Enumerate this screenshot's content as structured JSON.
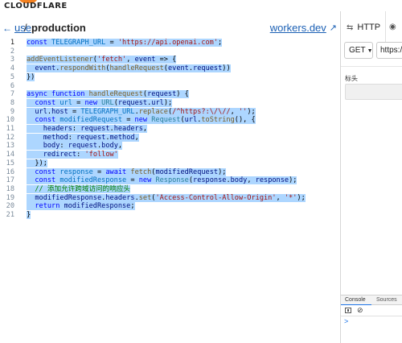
{
  "brand": {
    "logo_text": "CLOUDFLARE",
    "accent": "#f48120"
  },
  "header": {
    "back_label": "use",
    "separator": "/",
    "title": "production",
    "link_label": "workers.dev"
  },
  "panel": {
    "tab_http": "HTTP",
    "method": "GET",
    "url_value": "https://",
    "headers_label": "标头",
    "console_tab": "Console",
    "sources_tab": "Sources",
    "prompt": ">"
  },
  "editor": {
    "lines": [
      [
        [
          "kw",
          "const "
        ],
        [
          "cst",
          "TELEGRAPH_URL"
        ],
        [
          "plain",
          " = "
        ],
        [
          "str",
          "'https://api.openai.com'"
        ],
        [
          "plain",
          ";"
        ]
      ],
      [],
      [
        [
          "fn",
          "addEventListener"
        ],
        [
          "plain",
          "("
        ],
        [
          "str",
          "'fetch'"
        ],
        [
          "plain",
          ", "
        ],
        [
          "var",
          "event"
        ],
        [
          "plain",
          " => {"
        ]
      ],
      [
        [
          "plain",
          "  "
        ],
        [
          "var",
          "event"
        ],
        [
          "plain",
          "."
        ],
        [
          "fn",
          "respondWith"
        ],
        [
          "plain",
          "("
        ],
        [
          "fn",
          "handleRequest"
        ],
        [
          "plain",
          "("
        ],
        [
          "var",
          "event"
        ],
        [
          "plain",
          "."
        ],
        [
          "var",
          "request"
        ],
        [
          "plain",
          "))"
        ]
      ],
      [
        [
          "plain",
          "})"
        ]
      ],
      [],
      [
        [
          "kw",
          "async function "
        ],
        [
          "fn",
          "handleRequest"
        ],
        [
          "plain",
          "("
        ],
        [
          "var",
          "request"
        ],
        [
          "plain",
          ") {"
        ]
      ],
      [
        [
          "plain",
          "  "
        ],
        [
          "kw",
          "const "
        ],
        [
          "cst",
          "url"
        ],
        [
          "plain",
          " = "
        ],
        [
          "kw",
          "new "
        ],
        [
          "cls",
          "URL"
        ],
        [
          "plain",
          "("
        ],
        [
          "var",
          "request"
        ],
        [
          "plain",
          "."
        ],
        [
          "var",
          "url"
        ],
        [
          "plain",
          ");"
        ]
      ],
      [
        [
          "plain",
          "  "
        ],
        [
          "var",
          "url"
        ],
        [
          "plain",
          "."
        ],
        [
          "var",
          "host"
        ],
        [
          "plain",
          " = "
        ],
        [
          "cst",
          "TELEGRAPH_URL"
        ],
        [
          "plain",
          "."
        ],
        [
          "fn",
          "replace"
        ],
        [
          "plain",
          "("
        ],
        [
          "str",
          "/^https?:\\/\\//"
        ],
        [
          "plain",
          ", "
        ],
        [
          "str",
          "''"
        ],
        [
          "plain",
          ");"
        ]
      ],
      [
        [
          "plain",
          "  "
        ],
        [
          "kw",
          "const "
        ],
        [
          "cst",
          "modifiedRequest"
        ],
        [
          "plain",
          " = "
        ],
        [
          "kw",
          "new "
        ],
        [
          "cls",
          "Request"
        ],
        [
          "plain",
          "("
        ],
        [
          "var",
          "url"
        ],
        [
          "plain",
          "."
        ],
        [
          "fn",
          "toString"
        ],
        [
          "plain",
          "(), {"
        ]
      ],
      [
        [
          "plain",
          "    "
        ],
        [
          "var",
          "headers"
        ],
        [
          "plain",
          ": "
        ],
        [
          "var",
          "request"
        ],
        [
          "plain",
          "."
        ],
        [
          "var",
          "headers"
        ],
        [
          "plain",
          ","
        ]
      ],
      [
        [
          "plain",
          "    "
        ],
        [
          "var",
          "method"
        ],
        [
          "plain",
          ": "
        ],
        [
          "var",
          "request"
        ],
        [
          "plain",
          "."
        ],
        [
          "var",
          "method"
        ],
        [
          "plain",
          ","
        ]
      ],
      [
        [
          "plain",
          "    "
        ],
        [
          "var",
          "body"
        ],
        [
          "plain",
          ": "
        ],
        [
          "var",
          "request"
        ],
        [
          "plain",
          "."
        ],
        [
          "var",
          "body"
        ],
        [
          "plain",
          ","
        ]
      ],
      [
        [
          "plain",
          "    "
        ],
        [
          "var",
          "redirect"
        ],
        [
          "plain",
          ": "
        ],
        [
          "str",
          "'follow'"
        ]
      ],
      [
        [
          "plain",
          "  });"
        ]
      ],
      [
        [
          "plain",
          "  "
        ],
        [
          "kw",
          "const "
        ],
        [
          "cst",
          "response"
        ],
        [
          "plain",
          " = "
        ],
        [
          "kw",
          "await "
        ],
        [
          "fn",
          "fetch"
        ],
        [
          "plain",
          "("
        ],
        [
          "var",
          "modifiedRequest"
        ],
        [
          "plain",
          ");"
        ]
      ],
      [
        [
          "plain",
          "  "
        ],
        [
          "kw",
          "const "
        ],
        [
          "cst",
          "modifiedResponse"
        ],
        [
          "plain",
          " = "
        ],
        [
          "kw",
          "new "
        ],
        [
          "cls",
          "Response"
        ],
        [
          "plain",
          "("
        ],
        [
          "var",
          "response"
        ],
        [
          "plain",
          "."
        ],
        [
          "var",
          "body"
        ],
        [
          "plain",
          ", "
        ],
        [
          "var",
          "response"
        ],
        [
          "plain",
          ");"
        ]
      ],
      [
        [
          "plain",
          "  "
        ],
        [
          "cmt",
          "// 添加允许跨域访问的响应头"
        ]
      ],
      [
        [
          "plain",
          "  "
        ],
        [
          "var",
          "modifiedResponse"
        ],
        [
          "plain",
          "."
        ],
        [
          "var",
          "headers"
        ],
        [
          "plain",
          "."
        ],
        [
          "fn",
          "set"
        ],
        [
          "plain",
          "("
        ],
        [
          "str",
          "'Access-Control-Allow-Origin'"
        ],
        [
          "plain",
          ", "
        ],
        [
          "str",
          "'*'"
        ],
        [
          "plain",
          ");"
        ]
      ],
      [
        [
          "plain",
          "  "
        ],
        [
          "kw",
          "return "
        ],
        [
          "var",
          "modifiedResponse"
        ],
        [
          "plain",
          ";"
        ]
      ],
      [
        [
          "plain",
          "}"
        ]
      ]
    ]
  }
}
